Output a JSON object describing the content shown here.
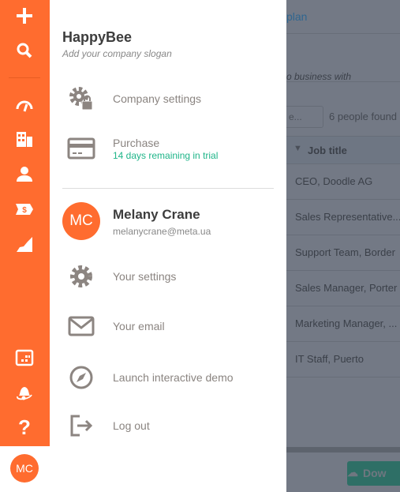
{
  "sidebar": {
    "items": [
      {
        "icon": "plus-icon"
      },
      {
        "icon": "search-icon"
      },
      {
        "icon": "dashboard-icon"
      },
      {
        "icon": "building-icon"
      },
      {
        "icon": "person-icon"
      },
      {
        "icon": "dollar-tag-icon"
      },
      {
        "icon": "chart-icon"
      },
      {
        "icon": "calendar-icon"
      },
      {
        "icon": "bell-icon"
      },
      {
        "icon": "help-icon"
      }
    ],
    "avatar_initials": "MC"
  },
  "menu": {
    "company_name": "HappyBee",
    "slogan": "Add your company slogan",
    "company_settings": "Company settings",
    "purchase": "Purchase",
    "trial": "14 days remaining in trial",
    "user": {
      "initials": "MC",
      "name": "Melany Crane",
      "email": "melanycrane@meta.ua"
    },
    "your_settings": "Your settings",
    "your_email": "Your email",
    "demo": "Launch interactive demo",
    "logout": "Log out"
  },
  "background": {
    "plan_link": "plan",
    "subtitle": "o business with",
    "search_placeholder": "e...",
    "count": "6 people found",
    "column": "Job title",
    "rows": [
      "CEO, Doodle AG",
      "Sales Representative...",
      "Support Team, Border",
      "Sales Manager, Porter",
      "Marketing Manager, ...",
      "IT Staff, Puerto"
    ],
    "download": "Dow"
  },
  "colors": {
    "accent": "#ff6c2f",
    "trial": "#1fb589",
    "download": "#2bb38c"
  }
}
